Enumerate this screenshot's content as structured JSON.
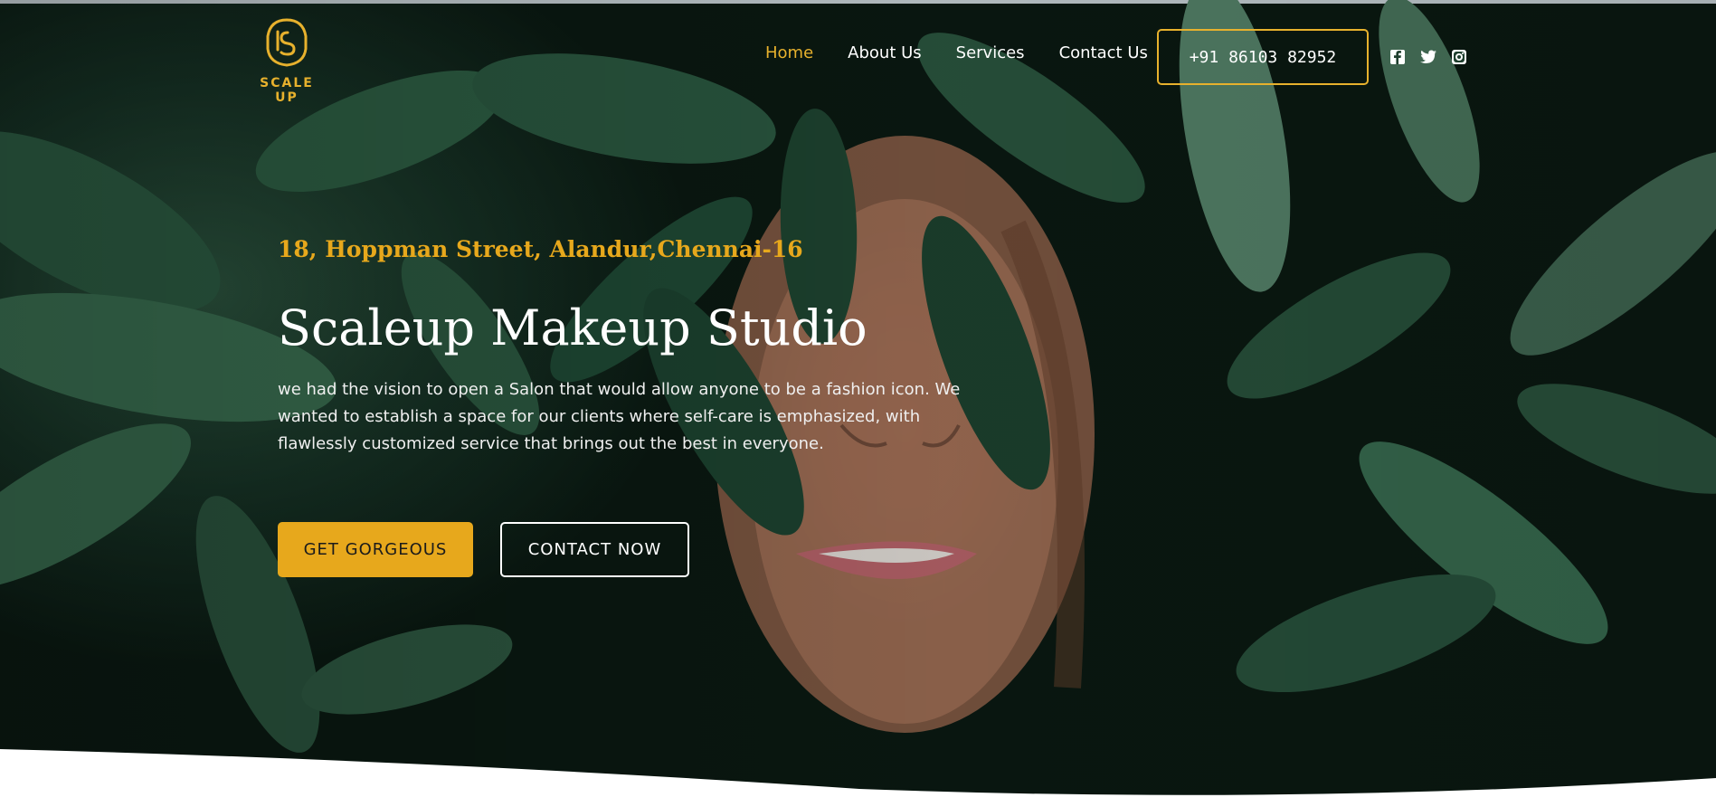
{
  "brand": {
    "logo_text": "SCALE UP",
    "accent_color": "#e7a81c"
  },
  "nav": {
    "items": [
      {
        "label": "Home",
        "active": true
      },
      {
        "label": "About Us",
        "active": false
      },
      {
        "label": "Services",
        "active": false
      },
      {
        "label": "Contact Us",
        "active": false
      }
    ]
  },
  "header": {
    "phone_label": "+91 86103 82952",
    "social_icons": [
      "facebook-icon",
      "twitter-icon",
      "instagram-icon"
    ]
  },
  "hero": {
    "address": "18, Hoppman Street, Alandur,Chennai-16",
    "title": "Scaleup Makeup Studio",
    "description": "we had the vision to open a Salon that would allow anyone to be a fashion icon. We wanted to establish a space for our clients where self-care is emphasized, with flawlessly customized service that brings out the best in everyone.",
    "primary_button": "GET GORGEOUS",
    "secondary_button": "CONTACT NOW"
  }
}
